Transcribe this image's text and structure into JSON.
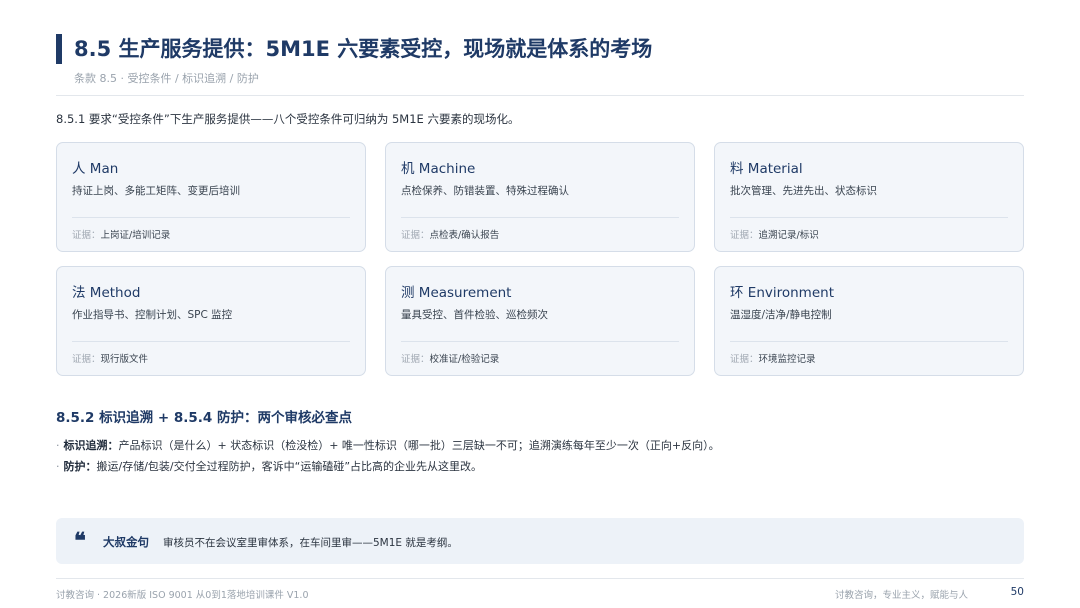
{
  "header": {
    "title": "8.5 生产服务提供：5M1E 六要素受控，现场就是体系的考场",
    "subtitle": "条款 8.5 · 受控条件 / 标识追溯 / 防护"
  },
  "intro": "8.5.1 要求“受控条件”下生产服务提供——八个受控条件可归纳为 5M1E 六要素的现场化。",
  "cards": [
    {
      "title": "人 Man",
      "desc": "持证上岗、多能工矩阵、变更后培训",
      "evidence_label": "证据：",
      "evidence": "上岗证/培训记录"
    },
    {
      "title": "机 Machine",
      "desc": "点检保养、防错装置、特殊过程确认",
      "evidence_label": "证据：",
      "evidence": "点检表/确认报告"
    },
    {
      "title": "料 Material",
      "desc": "批次管理、先进先出、状态标识",
      "evidence_label": "证据：",
      "evidence": "追溯记录/标识"
    },
    {
      "title": "法 Method",
      "desc": "作业指导书、控制计划、SPC 监控",
      "evidence_label": "证据：",
      "evidence": "现行版文件"
    },
    {
      "title": "测 Measurement",
      "desc": "量具受控、首件检验、巡检频次",
      "evidence_label": "证据：",
      "evidence": "校准证/检验记录"
    },
    {
      "title": "环 Environment",
      "desc": "温湿度/洁净/静电控制",
      "evidence_label": "证据：",
      "evidence": "环境监控记录"
    }
  ],
  "section2": {
    "title": "8.5.2 标识追溯 + 8.5.4 防护：两个审核必查点",
    "bullets": [
      {
        "dot": "·",
        "key": "标识追溯：",
        "text": "产品标识（是什么）+ 状态标识（检没检）+ 唯一性标识（哪一批）三层缺一不可；追溯演练每年至少一次（正向+反向）。"
      },
      {
        "dot": "·",
        "key": "防护：",
        "text": "搬运/存储/包装/交付全过程防护，客诉中“运输磕碰”占比高的企业先从这里改。"
      }
    ]
  },
  "quote": {
    "mark": "❝",
    "name": "大叔金句",
    "text": "审核员不在会议室里审体系，在车间里审——5M1E 就是考纲。"
  },
  "footer": {
    "left": "讨教咨询 · 2026新版 ISO 9001 从0到1落地培训课件 V1.0",
    "right": "讨教咨询，专业主义，赋能与人",
    "page": "50"
  }
}
